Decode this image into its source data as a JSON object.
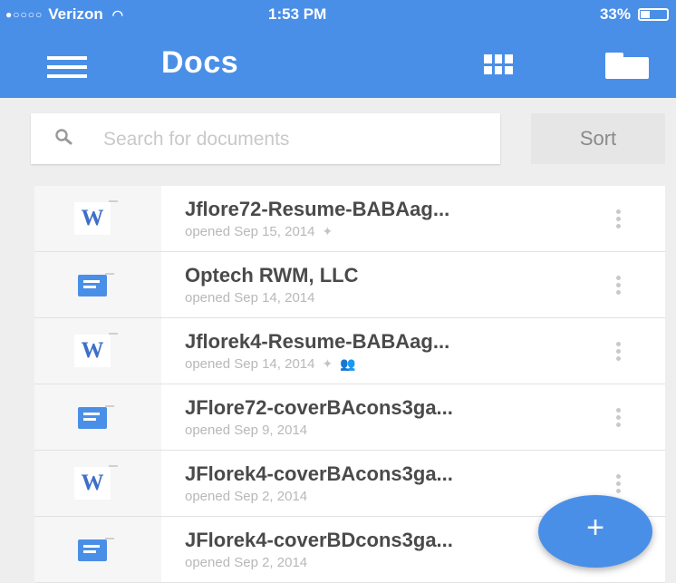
{
  "status_bar": {
    "carrier": "Verizon",
    "time": "1:53 PM",
    "battery": "33%",
    "signal_icon": "signal-dots-icon",
    "wifi_icon": "wifi-icon",
    "battery_icon": "battery-icon"
  },
  "appbar": {
    "title": "Docs",
    "menu_icon": "hamburger-menu-icon",
    "view_icon": "grid-view-icon",
    "folder_icon": "folder-icon",
    "accent": "#4a8fe7"
  },
  "search": {
    "placeholder": "Search for documents",
    "icon": "search-icon",
    "sort_label": "Sort"
  },
  "documents": [
    {
      "name": "Jflore72-Resume-BABAag...",
      "opened": "opened Sep 15, 2014",
      "type": "word",
      "badge": "W",
      "extra_icons": [
        "pin-icon"
      ]
    },
    {
      "name": "Optech RWM, LLC",
      "opened": "opened Sep 14, 2014",
      "type": "slides",
      "extra_icons": []
    },
    {
      "name": "Jflorek4-Resume-BABAag...",
      "opened": "opened Sep 14, 2014",
      "type": "word",
      "badge": "W",
      "extra_icons": [
        "pin-icon",
        "shared-icon"
      ]
    },
    {
      "name": "JFlore72-coverBAcons3ga...",
      "opened": "opened Sep 9, 2014",
      "type": "slides",
      "extra_icons": []
    },
    {
      "name": "JFlorek4-coverBAcons3ga...",
      "opened": "opened Sep 2, 2014",
      "type": "word",
      "badge": "W",
      "extra_icons": []
    },
    {
      "name": "JFlorek4-coverBDcons3ga...",
      "opened": "opened Sep 2, 2014",
      "type": "slides",
      "extra_icons": []
    }
  ],
  "fab": {
    "label": "+",
    "icon": "plus-icon"
  }
}
